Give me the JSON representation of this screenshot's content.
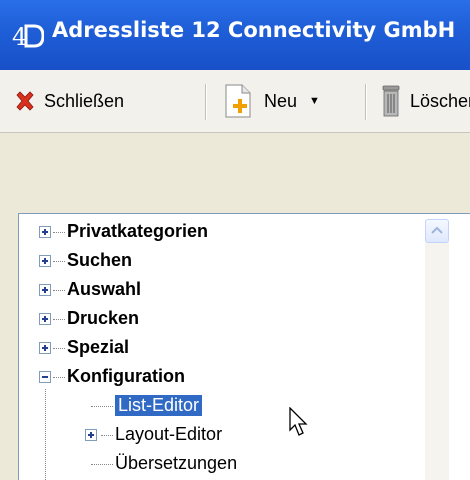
{
  "window": {
    "title": "Adressliste 12  Connectivity GmbH",
    "app_icon": "4d-logo-icon"
  },
  "toolbar": {
    "close_label": "Schließen",
    "new_label": "Neu",
    "delete_label": "Löschen",
    "dropdown_arrow": "▼"
  },
  "tree": {
    "items": [
      {
        "label": "Privatkategorien",
        "expander": "plus",
        "bold": true
      },
      {
        "label": "Suchen",
        "expander": "plus",
        "bold": true
      },
      {
        "label": "Auswahl",
        "expander": "plus",
        "bold": true
      },
      {
        "label": "Drucken",
        "expander": "plus",
        "bold": true
      },
      {
        "label": "Spezial",
        "expander": "plus",
        "bold": true
      },
      {
        "label": "Konfiguration",
        "expander": "minus",
        "bold": true
      }
    ],
    "children": [
      {
        "label": "List-Editor",
        "selected": true
      },
      {
        "label": "Layout-Editor",
        "expander": "plus"
      },
      {
        "label": "Übersetzungen"
      }
    ]
  },
  "colors": {
    "titlebar": "#1f5fd8",
    "selection": "#316ac5"
  }
}
